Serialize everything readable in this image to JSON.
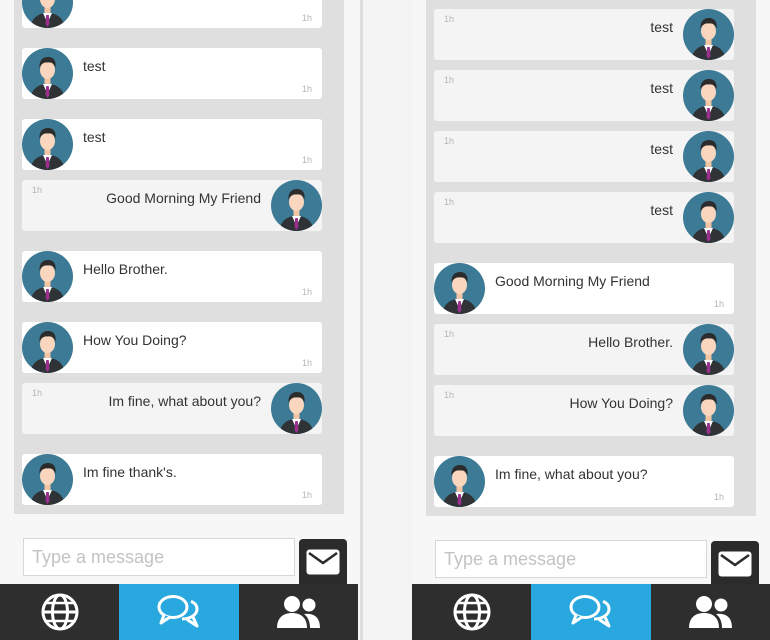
{
  "theme": {
    "accent": "#29a8df",
    "nav_bg": "#2e2e2e",
    "chat_bg": "#dfdfdf",
    "incoming_bg": "#ffffff",
    "outgoing_bg": "#f4f4f4",
    "avatar_bg": "#3c7a95"
  },
  "left_pane": {
    "messages": [
      {
        "direction": "in",
        "text": "",
        "time": "1h"
      },
      {
        "direction": "in",
        "text": "test",
        "time": "1h"
      },
      {
        "direction": "in",
        "text": "test",
        "time": "1h"
      },
      {
        "direction": "out",
        "text": "Good Morning My Friend",
        "time": "1h"
      },
      {
        "direction": "in",
        "text": "Hello Brother.",
        "time": "1h"
      },
      {
        "direction": "in",
        "text": "How You Doing?",
        "time": "1h"
      },
      {
        "direction": "out",
        "text": "Im fine, what about you?",
        "time": "1h"
      },
      {
        "direction": "in",
        "text": "Im fine thank's.",
        "time": "1h"
      }
    ],
    "composer": {
      "placeholder": "Type a message",
      "value": ""
    }
  },
  "right_pane": {
    "messages": [
      {
        "direction": "out",
        "text": "test",
        "time": "1h"
      },
      {
        "direction": "out",
        "text": "test",
        "time": "1h"
      },
      {
        "direction": "out",
        "text": "test",
        "time": "1h"
      },
      {
        "direction": "out",
        "text": "test",
        "time": "1h"
      },
      {
        "direction": "in",
        "text": "Good Morning My Friend",
        "time": "1h"
      },
      {
        "direction": "out",
        "text": "Hello Brother.",
        "time": "1h"
      },
      {
        "direction": "out",
        "text": "How You Doing?",
        "time": "1h"
      },
      {
        "direction": "in",
        "text": "Im fine, what about you?",
        "time": "1h"
      }
    ],
    "composer": {
      "placeholder": "Type a message",
      "value": ""
    }
  },
  "nav": {
    "tabs": [
      {
        "icon": "globe-icon",
        "active": false
      },
      {
        "icon": "chat-bubbles-icon",
        "active": true
      },
      {
        "icon": "users-icon",
        "active": false
      }
    ]
  },
  "send_icon": "envelope-icon"
}
